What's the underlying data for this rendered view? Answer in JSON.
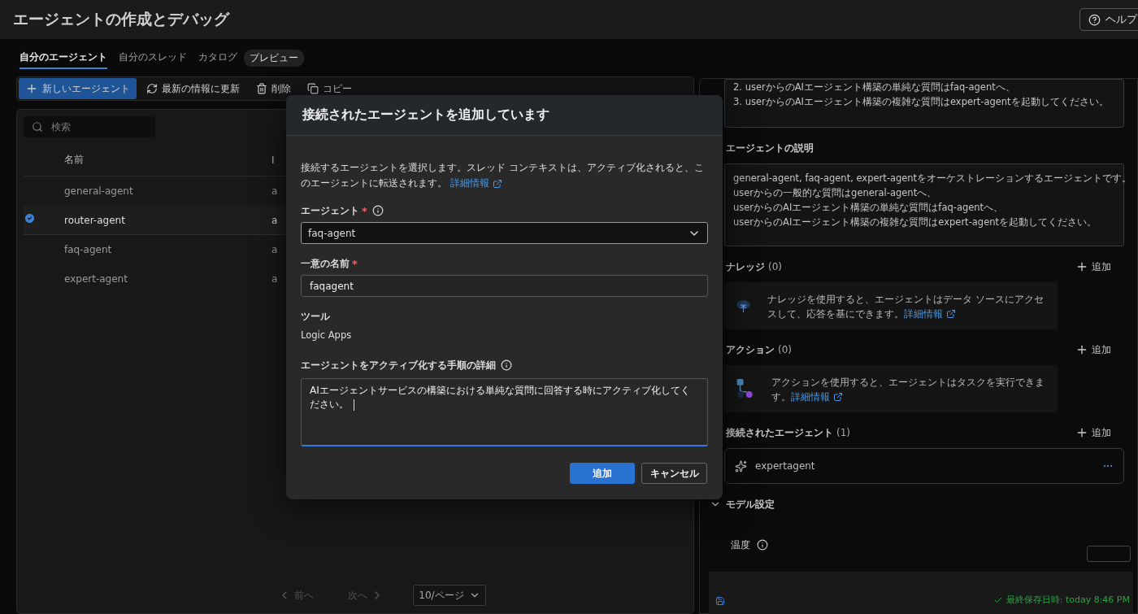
{
  "header": {
    "title": "エージェントの作成とデバッグ",
    "help": "ヘルプ"
  },
  "tabs": [
    {
      "label": "自分のエージェント",
      "selected": true
    },
    {
      "label": "自分のスレッド",
      "selected": false
    },
    {
      "label": "カタログ",
      "selected": false,
      "badge": "プレビュー"
    }
  ],
  "toolbar": [
    {
      "kind": "new",
      "label": "新しいエージェント"
    },
    {
      "kind": "refresh",
      "label": "最新の情報に更新"
    },
    {
      "kind": "delete",
      "label": "削除"
    },
    {
      "kind": "copy",
      "label": "コピー"
    }
  ],
  "search": {
    "placeholder": "検索"
  },
  "table": {
    "columns": [
      "名前",
      "I"
    ],
    "rows": [
      {
        "name": "general-agent",
        "column_2": "a",
        "selected": false
      },
      {
        "name": "router-agent",
        "column_2": "a",
        "selected": true
      },
      {
        "name": "faq-agent",
        "column_2": "a",
        "selected": false
      },
      {
        "name": "expert-agent",
        "column_2": "a",
        "selected": false
      }
    ]
  },
  "pagination": {
    "prev": "前へ",
    "next": "次へ",
    "page_size": "10/ページ"
  },
  "details": {
    "instructions": [
      "2. userからのAIエージェント構築の単純な質問はfaq-agentへ、",
      "3. userからのAIエージェント構築の複雑な質問はexpert-agentを起動してください。"
    ],
    "sections": [
      {
        "kind": "text",
        "title": "エージェントの説明",
        "lines": [
          "general-agent, faq-agent, expert-agentをオーケストレーションするエージェントです。",
          "userからの一般的な質問はgeneral-agentへ、",
          "userからのAIエージェント構築の単純な質問はfaq-agentへ、",
          "userからのAIエージェント構築の複雑な質問はexpert-agentを起動してください。"
        ]
      },
      {
        "kind": "knowledge",
        "title": "ナレッジ",
        "count": "(0)",
        "add": "追加",
        "text": "ナレッジを使用すると、エージェントはデータ ソースにアクセスして、応答を基にできます。",
        "link": "詳細情報"
      },
      {
        "kind": "actions",
        "title": "アクション",
        "count": "(0)",
        "add": "追加",
        "text": "アクションを使用すると、エージェントはタスクを実行できます。",
        "link": "詳細情報"
      },
      {
        "kind": "agents",
        "title": "接続されたエージェント",
        "count": "(1)",
        "add": "追加",
        "items": [
          "expertagent"
        ]
      },
      {
        "kind": "settings",
        "title": "モデル設定",
        "expanded": true,
        "fields": [
          "温度"
        ]
      }
    ]
  },
  "status_bar": {
    "saved": "最終保存日時: today 8:46 PM"
  },
  "dialog": {
    "title": "接続されたエージェントを追加しています",
    "intro": "接続するエージェントを選択します。スレッド コンテキストは、アクティブ化されると、このエージェントに転送されます。",
    "intro_link": "詳細情報",
    "agent_label": "エージェント",
    "agent_required": "*",
    "agent_value": "faq-agent",
    "name_label": "一意の名前",
    "name_required": "*",
    "name_value": "faqagent",
    "tool_label": "ツール",
    "tool_value": "Logic Apps",
    "steps_label": "エージェントをアクティブ化する手順の詳細",
    "steps_value": "AIエージェントサービスの構築における単純な質問に回答する時にアクティブ化してください。",
    "ok": "追加",
    "cancel": "キャンセル"
  }
}
